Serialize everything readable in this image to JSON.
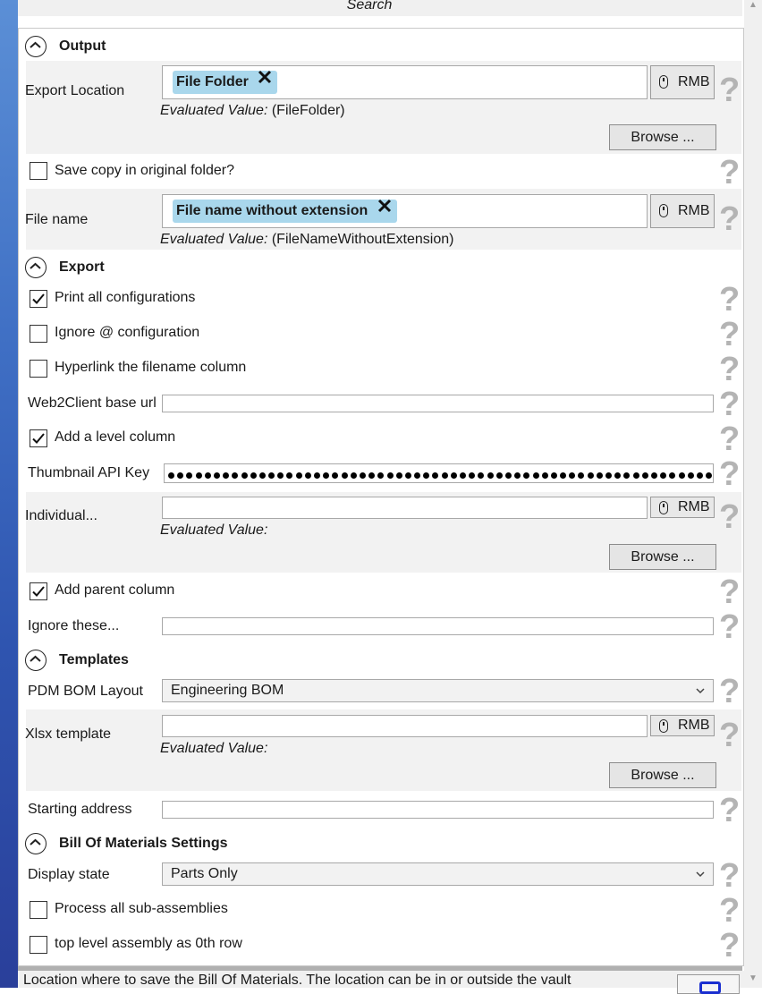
{
  "search": {
    "label": "Search"
  },
  "sections": {
    "output": "Output",
    "export": "Export",
    "templates": "Templates",
    "bom_settings": "Bill Of Materials Settings"
  },
  "output": {
    "export_location": {
      "label": "Export Location",
      "chip": "File Folder",
      "evaluated_label": "Evaluated Value:",
      "evaluated_value": "(FileFolder)",
      "rmb": "RMB",
      "browse": "Browse ..."
    },
    "save_copy": {
      "label": "Save copy in original folder?",
      "checked": false
    },
    "file_name": {
      "label": "File name",
      "chip": "File name without extension",
      "evaluated_label": "Evaluated Value:",
      "evaluated_value": "(FileNameWithoutExtension)",
      "rmb": "RMB"
    }
  },
  "export": {
    "print_all": {
      "label": "Print all configurations",
      "checked": true
    },
    "ignore_at": {
      "label": "Ignore @ configuration",
      "checked": false
    },
    "hyperlink": {
      "label": "Hyperlink the filename column",
      "checked": false
    },
    "web2client": {
      "label": "Web2Client base url",
      "value": ""
    },
    "level_column": {
      "label": "Add a level column",
      "checked": true
    },
    "thumbnail_key": {
      "label": "Thumbnail API Key",
      "masked_length": 61
    },
    "individual": {
      "label": "Individual...",
      "value": "",
      "evaluated_label": "Evaluated Value:",
      "rmb": "RMB",
      "browse": "Browse ..."
    },
    "parent_column": {
      "label": "Add parent column",
      "checked": true
    },
    "ignore_these": {
      "label": "Ignore these...",
      "value": ""
    }
  },
  "templates": {
    "pdm_layout": {
      "label": "PDM BOM Layout",
      "selected": "Engineering BOM"
    },
    "xlsx": {
      "label": "Xlsx template",
      "value": "",
      "evaluated_label": "Evaluated Value:",
      "rmb": "RMB",
      "browse": "Browse ..."
    },
    "starting_address": {
      "label": "Starting address",
      "value": ""
    }
  },
  "bom": {
    "display_state": {
      "label": "Display state",
      "selected": "Parts Only"
    },
    "process_sub": {
      "label": "Process all sub-assemblies",
      "checked": false
    },
    "top_level": {
      "label": "top level assembly as 0th row",
      "checked": false
    }
  },
  "help_glyph": "?",
  "description": "Location where to save the Bill Of Materials. The location can be in or outside the vault",
  "colors": {
    "chip": "#a9d7ec",
    "row_grey": "#f2f2f2",
    "help": "#b4b4b4",
    "left_accent": "#3f6fc4"
  }
}
